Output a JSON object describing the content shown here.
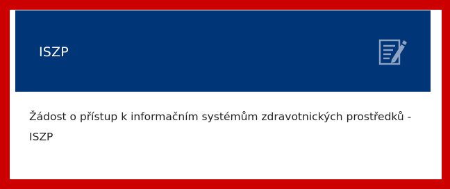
{
  "card": {
    "title": "ISZP",
    "icon": "form-edit-icon",
    "description": "Žádost o přístup k informačním systémům zdravotnických prostředků - ISZP"
  },
  "colors": {
    "highlight_border": "#cc0000",
    "header_background": "#003578",
    "header_text": "#ffffff",
    "icon_color": "#8fa3c2",
    "body_text": "#222222"
  }
}
